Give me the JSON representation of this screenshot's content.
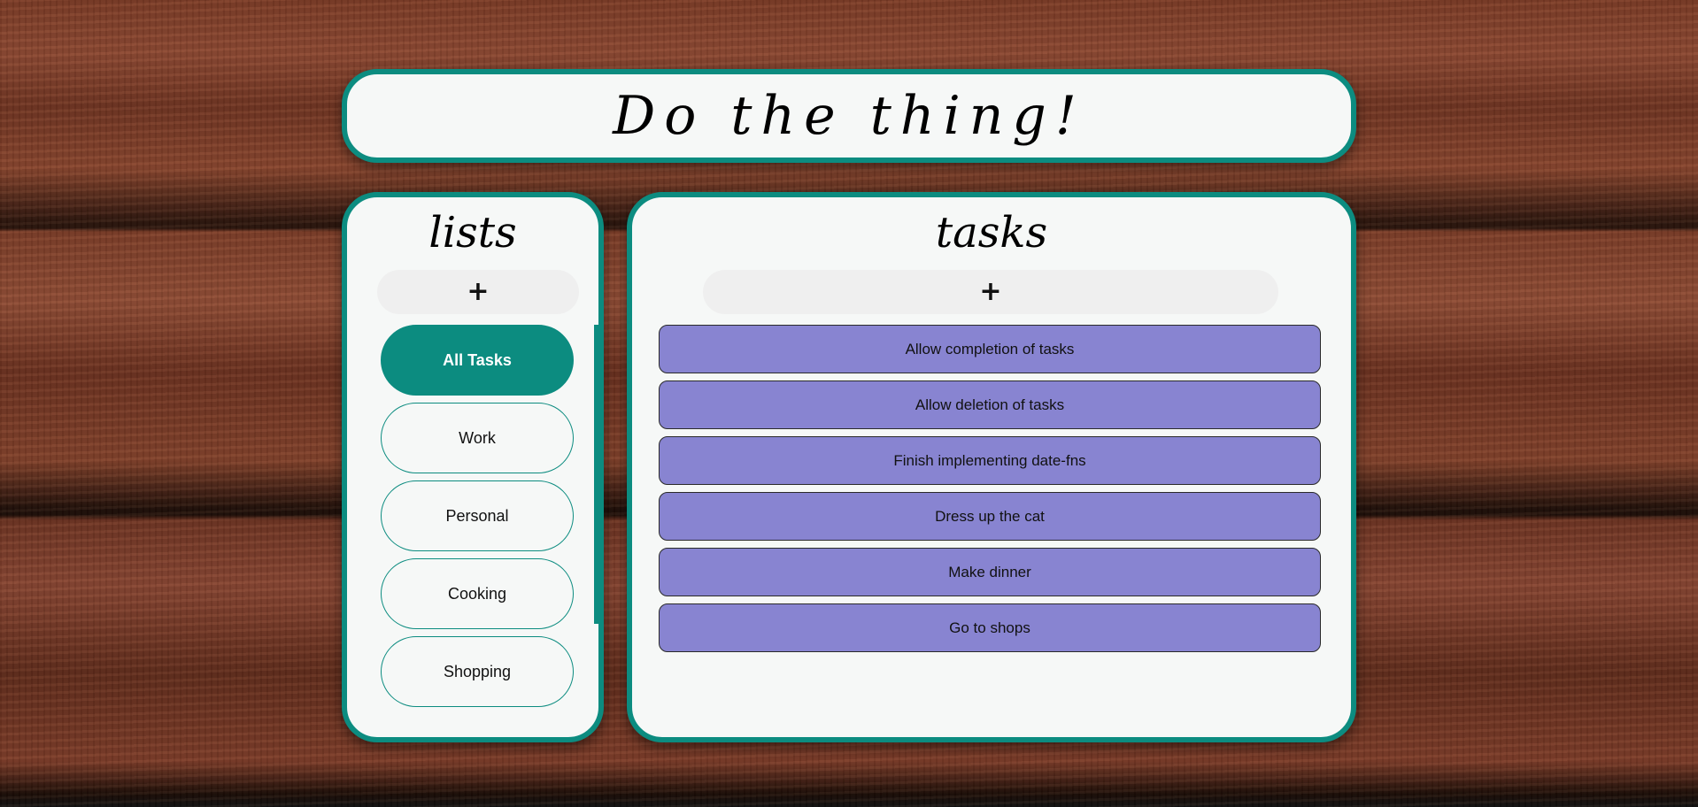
{
  "header": {
    "title": "Do the thing!"
  },
  "lists": {
    "title": "lists",
    "add_label": "+",
    "items": [
      {
        "label": "All Tasks",
        "active": true
      },
      {
        "label": "Work",
        "active": false
      },
      {
        "label": "Personal",
        "active": false
      },
      {
        "label": "Cooking",
        "active": false
      },
      {
        "label": "Shopping",
        "active": false
      }
    ]
  },
  "tasks": {
    "title": "tasks",
    "add_label": "+",
    "items": [
      {
        "label": "Allow completion of tasks"
      },
      {
        "label": "Allow deletion of tasks"
      },
      {
        "label": "Finish implementing date-fns"
      },
      {
        "label": "Dress up the cat"
      },
      {
        "label": "Make dinner"
      },
      {
        "label": "Go to shops"
      }
    ]
  },
  "colors": {
    "accent": "#0c8c80",
    "task_fill": "#8884d1",
    "panel_bg": "#f6f8f7",
    "add_bg": "#efefef"
  }
}
